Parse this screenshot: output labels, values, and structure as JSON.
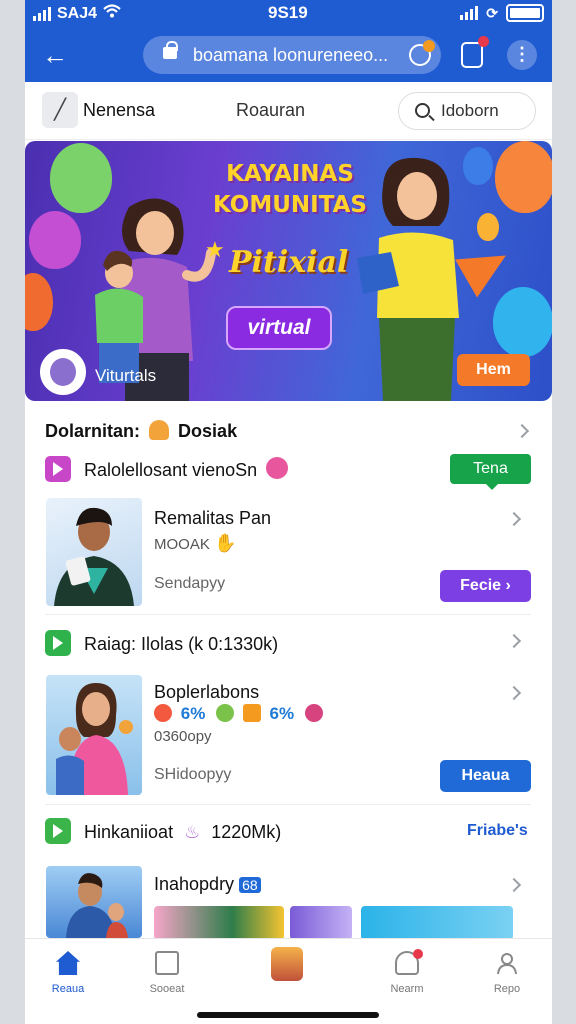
{
  "status_bar": {
    "carrier": "SAJ4",
    "time": "9S19"
  },
  "browser": {
    "url": "boamana loonureneeo..."
  },
  "toolbar": {
    "edit_label": "Nenensa",
    "center_label": "Roauran",
    "search_label": "Idoborn"
  },
  "banner": {
    "title_line1": "KAYAINAS",
    "title_line2": "KOMUNITAS",
    "subtitle": "Pitixial",
    "pill_label": "virtual",
    "profile_name": "Viturtals",
    "cta_label": "Hem"
  },
  "section": {
    "header_prefix": "Dolarnitan:",
    "header_suffix": "Dosiak"
  },
  "feed": [
    {
      "head": "Ralolellosant vienoSn",
      "head_color": "#c847c9",
      "tag": "Tena",
      "title": "Remalitas Pan",
      "meta": "MOOAK",
      "sub": "Sendapyy",
      "button": "Fecie",
      "button_color": "#7b3fe4"
    },
    {
      "head": "Raiag: Ilolas (k 0:1330k)",
      "head_color": "#2fb24c",
      "title": "Boplerlabons",
      "stats": [
        "6%",
        "6%"
      ],
      "meta": "0360opy",
      "sub": "SHidoopyy",
      "button": "Heaua",
      "button_color": "#1f6ad6"
    },
    {
      "head": "Hinkaniioat",
      "head_extra": "1220Mk)",
      "head_color": "#3bb54a",
      "link": "Friabe's",
      "title": "Inahopdry",
      "badge": "68"
    }
  ],
  "bottom_nav": [
    {
      "label": "Reaua"
    },
    {
      "label": "Sooeat"
    },
    {
      "label": ""
    },
    {
      "label": "Nearm"
    },
    {
      "label": "Repo"
    }
  ],
  "colors": {
    "brand_blue": "#1f5bd1",
    "green": "#16a34a",
    "purple": "#7b3fe4",
    "orange": "#f47a2a"
  }
}
